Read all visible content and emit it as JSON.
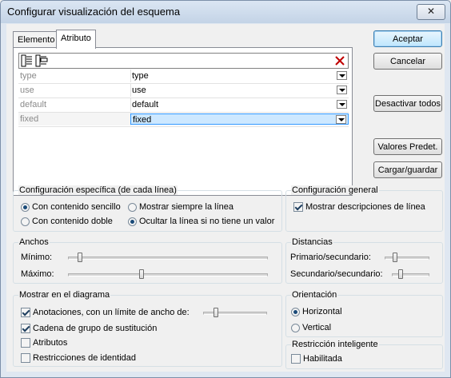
{
  "window": {
    "title": "Configurar visualización del esquema",
    "close_glyph": "✕"
  },
  "tabs": [
    {
      "label": "Elemento",
      "active": false
    },
    {
      "label": "Atributo",
      "active": true
    }
  ],
  "toolbar": {
    "icons": [
      "append-line-icon",
      "insert-line-icon",
      "delete-icon"
    ]
  },
  "attributes": [
    {
      "name": "type",
      "value": "type",
      "selected": false
    },
    {
      "name": "use",
      "value": "use",
      "selected": false
    },
    {
      "name": "default",
      "value": "default",
      "selected": false
    },
    {
      "name": "fixed",
      "value": "fixed",
      "selected": true
    }
  ],
  "buttons": {
    "accept": "Aceptar",
    "cancel": "Cancelar",
    "disable_all": "Desactivar todos",
    "default_values": "Valores Predet.",
    "load_save": "Cargar/guardar"
  },
  "line_config": {
    "title": "Configuración específica (de cada línea)",
    "with_simple": "Con contenido sencillo",
    "with_double": "Con contenido doble",
    "always_show": "Mostrar siempre la línea",
    "hide_if_no_value": "Ocultar la línea si no tiene un valor",
    "selected_content": "with_simple",
    "selected_visibility": "hide_if_no_value"
  },
  "general_config": {
    "title": "Configuración general",
    "show_descriptions": "Mostrar descripciones de línea",
    "show_descriptions_checked": true
  },
  "widths": {
    "title": "Anchos",
    "min_label": "Mínimo:",
    "max_label": "Máximo:",
    "min_level": 0.05,
    "max_level": 0.5
  },
  "distances": {
    "title": "Distancias",
    "primary_label": "Primario/secundario:",
    "secondary_label": "Secundario/secundario:",
    "primary_level": 0.3,
    "secondary_level": 0.25
  },
  "diagram": {
    "title": "Mostrar en el diagrama",
    "annotations": "Anotaciones, con un límite de ancho de:",
    "annotations_checked": true,
    "annotations_level": 0.2,
    "substitution": "Cadena de grupo de sustitución",
    "substitution_checked": true,
    "attributes": "Atributos",
    "attributes_checked": false,
    "identity": "Restricciones de identidad",
    "identity_checked": false
  },
  "orientation": {
    "title": "Orientación",
    "horizontal": "Horizontal",
    "vertical": "Vertical",
    "selected": "horizontal"
  },
  "smart_restriction": {
    "title": "Restricción inteligente",
    "enabled": "Habilitada",
    "enabled_checked": false
  },
  "colors": {
    "title_bg": "#c3d3e6",
    "selection": "#cde8ff",
    "delete_icon": "#c00000"
  }
}
